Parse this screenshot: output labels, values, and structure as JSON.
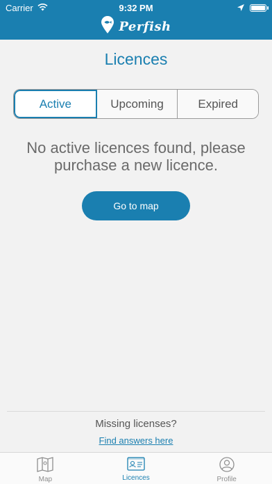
{
  "status_bar": {
    "carrier": "Carrier",
    "time": "9:32 PM"
  },
  "header": {
    "brand": "Perfish"
  },
  "page": {
    "title": "Licences"
  },
  "segments": [
    {
      "label": "Active",
      "selected": true
    },
    {
      "label": "Upcoming",
      "selected": false
    },
    {
      "label": "Expired",
      "selected": false
    }
  ],
  "empty_state": {
    "message": "No active licences found, please purchase a new licence.",
    "button_label": "Go to map"
  },
  "footer": {
    "question": "Missing licenses?",
    "link": "Find answers here"
  },
  "tabbar": {
    "items": [
      {
        "label": "Map",
        "icon": "map-icon",
        "active": false
      },
      {
        "label": "Licences",
        "icon": "licence-card-icon",
        "active": true
      },
      {
        "label": "Profile",
        "icon": "profile-icon",
        "active": false
      }
    ]
  },
  "colors": {
    "accent": "#1a7fb0",
    "background": "#f2f2f2",
    "text_gray": "#6a6a6a"
  }
}
